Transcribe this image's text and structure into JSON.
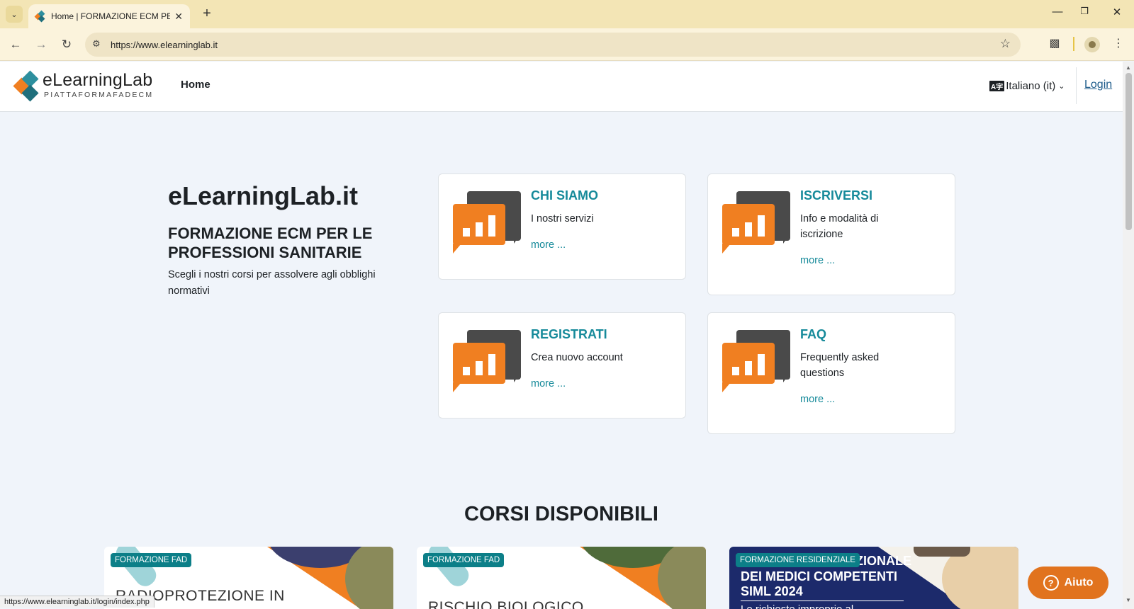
{
  "browser": {
    "tab_title": "Home | FORMAZIONE ECM PER LE PROFESSIONI SANITARIE",
    "url": "https://www.elearninglab.it",
    "status_url": "https://www.elearninglab.it/login/index.php",
    "icons": [
      "tab-menu-icon",
      "close-icon",
      "plus-icon",
      "minimize-icon",
      "restore-icon",
      "back-icon",
      "forward-icon",
      "reload-icon",
      "site-info-icon",
      "star-icon",
      "extensions-icon",
      "profile-icon",
      "more-icon"
    ]
  },
  "header": {
    "logo_text": "eLearningLab",
    "logo_subtitle": "PIATTAFORMAFADECM",
    "nav_home": "Home",
    "language": "Italiano (it)",
    "login": "Login"
  },
  "hero": {
    "title": "eLearningLab.it",
    "subtitle": "FORMAZIONE ECM PER LE PROFESSIONI SANITARIE",
    "description": "Scegli i nostri corsi per assolvere agli obblighi normativi"
  },
  "cards": [
    {
      "title": "CHI SIAMO",
      "text": "I nostri servizi",
      "more": "more ..."
    },
    {
      "title": "ISCRIVERSI",
      "text": "Info e modalità di iscrizione",
      "more": "more ..."
    },
    {
      "title": "REGISTRATI",
      "text": "Crea nuovo account",
      "more": "more ..."
    },
    {
      "title": "FAQ",
      "text": "Frequently asked questions",
      "more": "more ..."
    }
  ],
  "courses_section": {
    "title": "CORSI DISPONIBILI",
    "courses": [
      {
        "badge": "FORMAZIONE FAD",
        "image_text": "RADIOPROTEZIONE IN"
      },
      {
        "badge": "FORMAZIONE FAD",
        "image_text": "RISCHIO BIOLOGICO"
      },
      {
        "badge": "FORMAZIONE RESIDENZIALE",
        "image_line1": "ZIONALE",
        "image_line2": "DEI MEDICI COMPETENTI",
        "image_line3": "SIML 2024",
        "image_line4": "Le richieste improprie al"
      }
    ]
  },
  "help": {
    "label": "Aiuto"
  },
  "colors": {
    "accent_teal": "#168a9a",
    "orange": "#f07f21",
    "badge": "#0c7f88",
    "help_button": "#e1731e"
  }
}
